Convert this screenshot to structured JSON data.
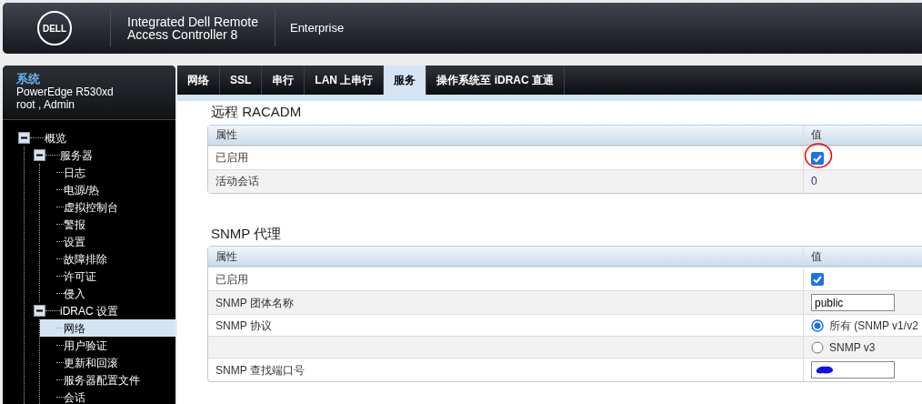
{
  "header": {
    "logo_text": "DELL",
    "product_line_1": "Integrated Dell Remote",
    "product_line_2": "Access Controller 8",
    "edition": "Enterprise"
  },
  "sidebar": {
    "title": "系统",
    "model": "PowerEdge R530xd",
    "user": "root , Admin",
    "tree": [
      {
        "label": "概览",
        "expanded": true,
        "selected": false,
        "children": [
          {
            "label": "服务器",
            "expanded": true,
            "selected": false,
            "children": [
              {
                "label": "日志",
                "selected": false
              },
              {
                "label": "电源/热",
                "selected": false
              },
              {
                "label": "虚拟控制台",
                "selected": false
              },
              {
                "label": "警报",
                "selected": false
              },
              {
                "label": "设置",
                "selected": false
              },
              {
                "label": "故障排除",
                "selected": false
              },
              {
                "label": "许可证",
                "selected": false
              },
              {
                "label": "侵入",
                "selected": false
              }
            ]
          },
          {
            "label": "iDRAC 设置",
            "expanded": true,
            "selected": false,
            "children": [
              {
                "label": "网络",
                "selected": true
              },
              {
                "label": "用户验证",
                "selected": false
              },
              {
                "label": "更新和回滚",
                "selected": false
              },
              {
                "label": "服务器配置文件",
                "selected": false
              },
              {
                "label": "会话",
                "selected": false
              }
            ]
          }
        ]
      }
    ]
  },
  "tabs": [
    {
      "label": "网络",
      "selected": false
    },
    {
      "label": "SSL",
      "selected": false
    },
    {
      "label": "串行",
      "selected": false
    },
    {
      "label": "LAN 上串行",
      "selected": false
    },
    {
      "label": "服务",
      "selected": true
    },
    {
      "label": "操作系统至 iDRAC 直通",
      "selected": false
    }
  ],
  "sections": [
    {
      "title": "远程 RACADM",
      "columns": [
        "属性",
        "值"
      ],
      "rows": [
        {
          "label": "已启用",
          "kind": "checkbox",
          "checked": true,
          "annotated": true
        },
        {
          "label": "活动会话",
          "kind": "text",
          "value": "0"
        }
      ]
    },
    {
      "title": "SNMP 代理",
      "columns": [
        "属性",
        "值"
      ],
      "rows": [
        {
          "label": "已启用",
          "kind": "checkbox",
          "checked": true
        },
        {
          "label": "SNMP 团体名称",
          "kind": "input",
          "value": "public"
        },
        {
          "label": "SNMP 协议",
          "kind": "radio",
          "option": "所有 (SNMP v1/v2",
          "selected": true
        },
        {
          "kind": "radio",
          "option": "SNMP v3",
          "selected": false
        },
        {
          "label": "SNMP 查找端口号",
          "kind": "input",
          "redacted": true
        }
      ]
    }
  ]
}
